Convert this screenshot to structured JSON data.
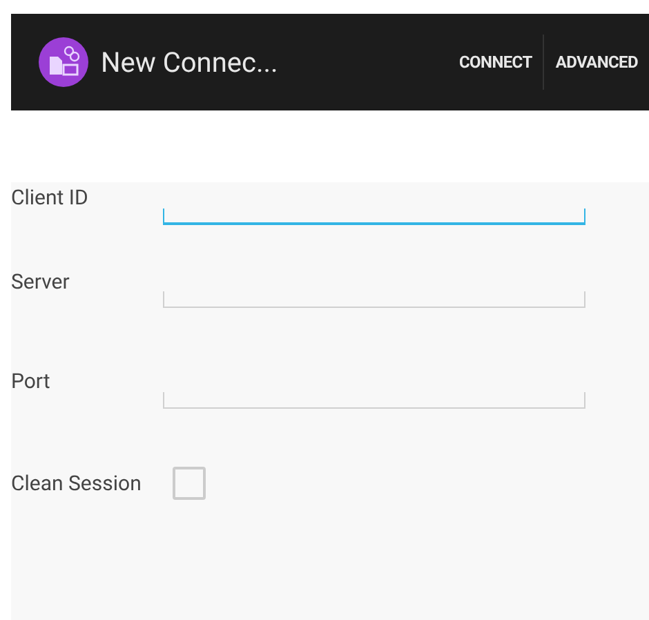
{
  "action_bar": {
    "title": "New Connec...",
    "actions": [
      {
        "label": "CONNECT"
      },
      {
        "label": "ADVANCED"
      }
    ]
  },
  "fields": [
    {
      "label": "Client ID",
      "focused": true
    },
    {
      "label": "Server",
      "focused": false
    },
    {
      "label": "Port",
      "focused": false
    }
  ],
  "clean_session": {
    "label": "Clean Session",
    "checked": false
  }
}
